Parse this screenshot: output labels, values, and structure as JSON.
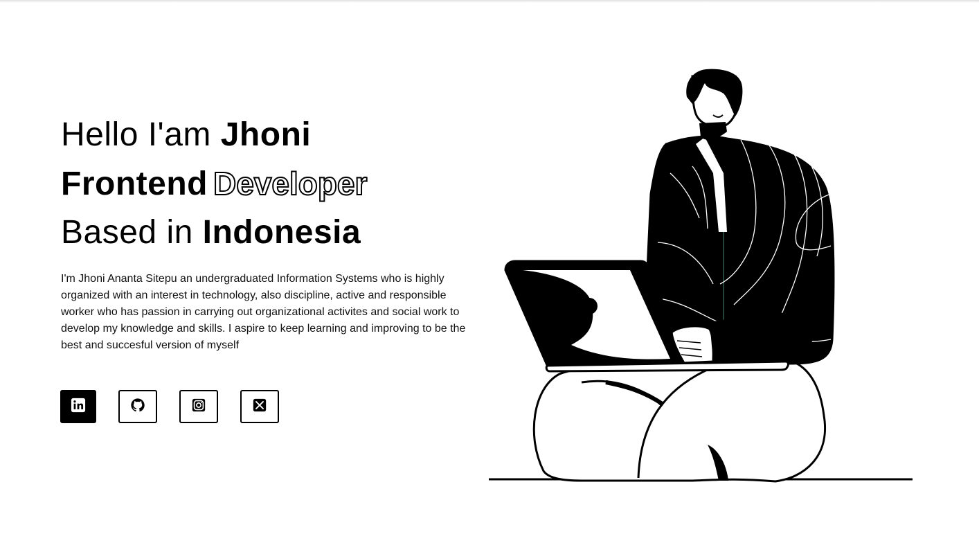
{
  "hero": {
    "line1_regular": "Hello I'am ",
    "line1_bold": "Jhoni",
    "line2_bold": "Frontend",
    "line2_outline": "Developer",
    "line3_regular": "Based in ",
    "line3_bold": "Indonesia",
    "bio": "I'm Jhoni Ananta Sitepu an undergraduated Information Systems who is highly organized with an interest in technology, also discipline, active and responsible worker who has passion in carrying out organizational activites and social work to develop my knowledge and skills. I aspire to keep learning and improving to be the best and succesful version of myself"
  },
  "socials": [
    {
      "name": "linkedin",
      "icon": "linkedin-icon",
      "active": true
    },
    {
      "name": "github",
      "icon": "github-icon",
      "active": false
    },
    {
      "name": "instagram",
      "icon": "instagram-icon",
      "active": false
    },
    {
      "name": "x",
      "icon": "x-icon",
      "active": false
    }
  ],
  "colors": {
    "text": "#000000",
    "background": "#ffffff",
    "accent": "#000000"
  }
}
